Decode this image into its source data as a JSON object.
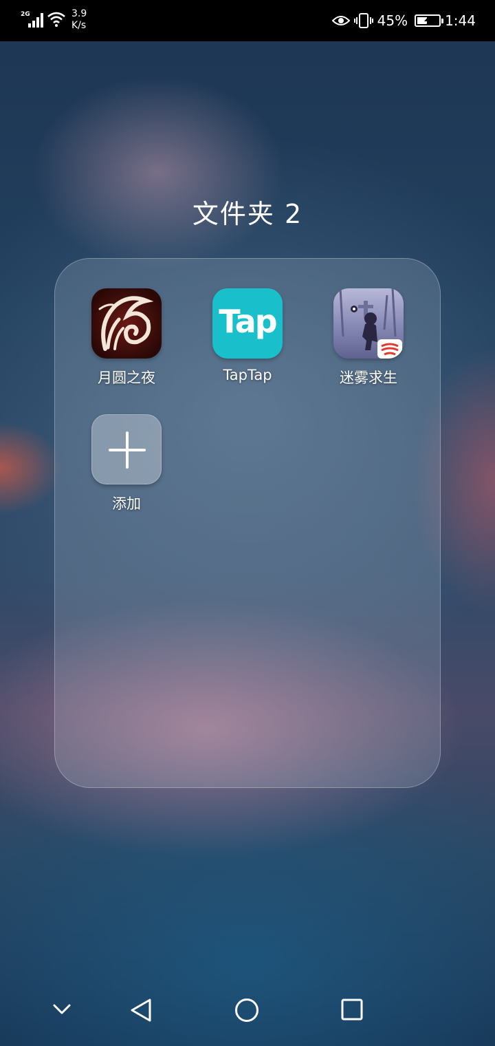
{
  "status_bar": {
    "network_type": "2G",
    "net_speed_value": "3.9",
    "net_speed_unit": "K/s",
    "battery_percent": "45%",
    "battery_level": 0.45,
    "time": "1:44",
    "icons": [
      "signal-icon",
      "wifi-icon",
      "eye-comfort-icon",
      "vibrate-icon",
      "battery-charging-icon"
    ]
  },
  "folder": {
    "title": "文件夹 2",
    "apps": [
      {
        "label": "月圆之夜",
        "icon": "moon-night-app-icon"
      },
      {
        "label": "TapTap",
        "icon": "taptap-app-icon",
        "icon_text": "Tap",
        "color": "#19c0cc"
      },
      {
        "label": "迷雾求生",
        "icon": "fog-survival-app-icon"
      }
    ],
    "add_button": {
      "label": "添加",
      "icon": "plus-icon"
    }
  },
  "nav_bar": {
    "buttons": [
      "collapse-icon",
      "back-icon",
      "home-icon",
      "recents-icon"
    ]
  }
}
